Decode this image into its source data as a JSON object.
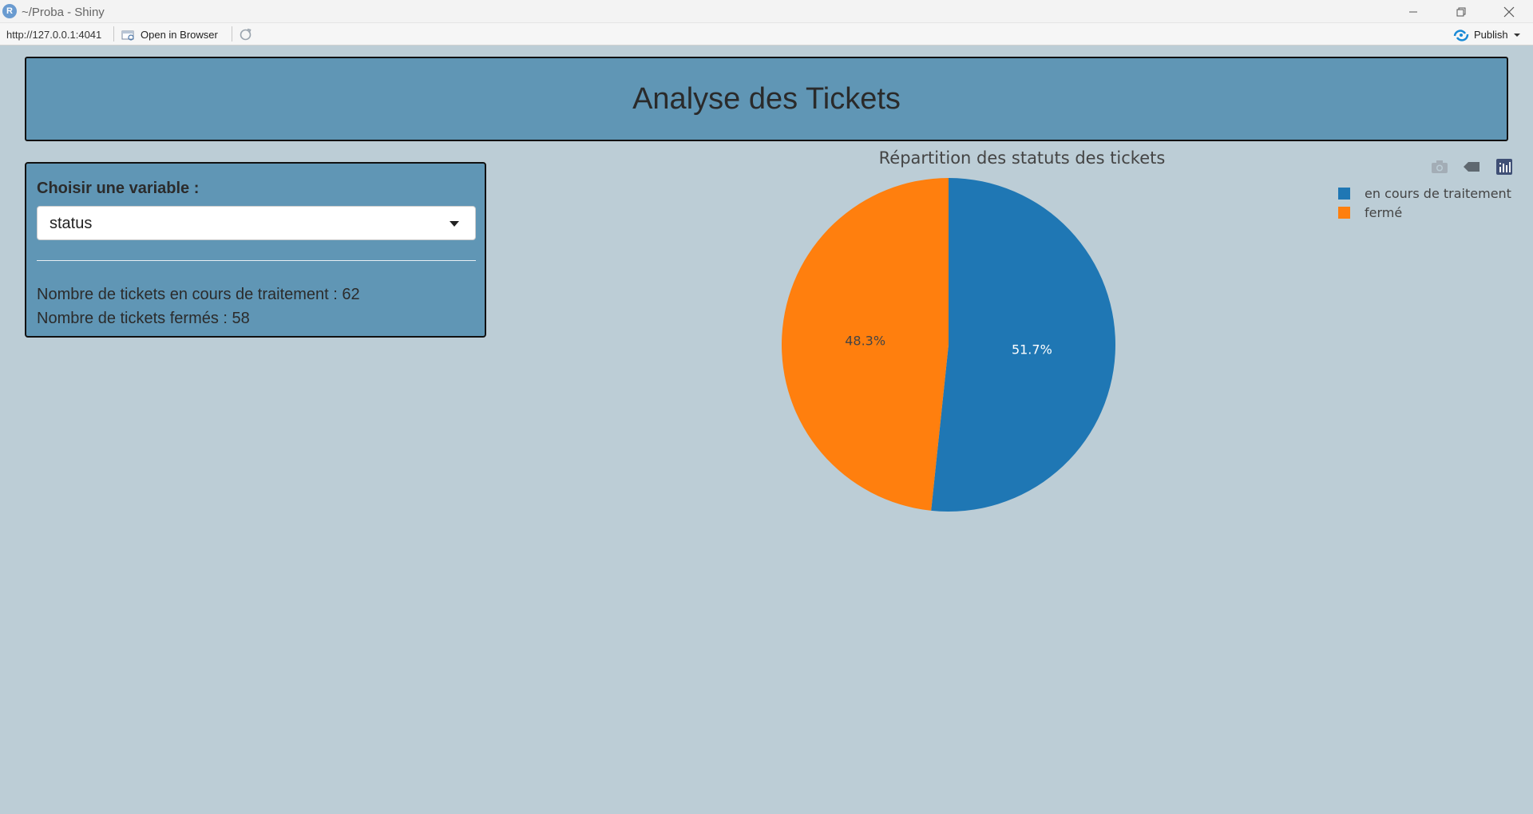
{
  "window": {
    "title": "~/Proba - Shiny",
    "app_icon_letter": "R"
  },
  "toolbar": {
    "url": "http://127.0.0.1:4041",
    "open_in_browser_label": "Open in Browser",
    "publish_label": "Publish"
  },
  "header": {
    "title": "Analyse des Tickets"
  },
  "sidebar": {
    "select_label": "Choisir une variable :",
    "selected_value": "status",
    "count_open": "Nombre de tickets en cours de traitement : 62",
    "count_closed": "Nombre de tickets fermés : 58"
  },
  "plot": {
    "modebar_icons": [
      "camera-icon",
      "tag-icon",
      "plotly-logo-icon"
    ]
  },
  "chart_data": {
    "type": "pie",
    "title": "Répartition des statuts des tickets",
    "labels": [
      "en cours de traitement",
      "fermé"
    ],
    "values": [
      62,
      58
    ],
    "percent_labels": [
      "51.7%",
      "48.3%"
    ],
    "colors": [
      "#1f77b4",
      "#ff7f0e"
    ],
    "legend_position": "top-right"
  }
}
